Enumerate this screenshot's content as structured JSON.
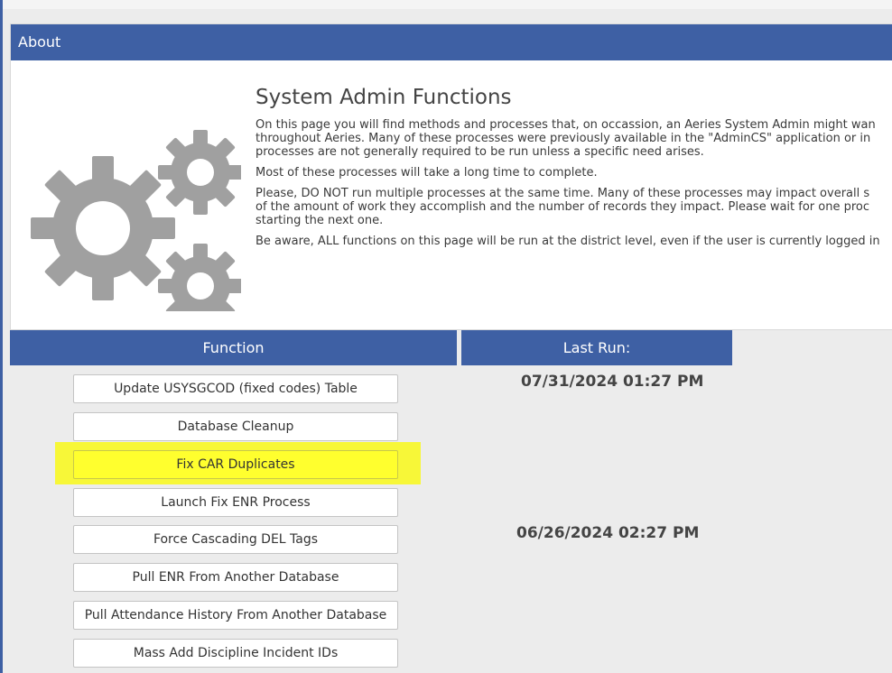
{
  "about": {
    "header": "About",
    "title": "System Admin Functions",
    "paragraphs": [
      [
        "On this page you will find methods and processes that, on occassion, an Aeries System Admin might wan",
        "throughout Aeries. Many of these processes were previously available in the \"AdminCS\" application or in",
        "processes are not generally required to be run unless a specific need arises."
      ],
      [
        "Most of these processes will take a long time to complete."
      ],
      [
        "Please, DO NOT run multiple processes at the same time. Many of these processes may impact overall s",
        "of the amount of work they accomplish and the number of records they impact. Please wait for one proc",
        "starting the next one."
      ],
      [
        "Be aware, ALL functions on this page will be run at the district level, even if the user is currently logged in"
      ]
    ],
    "icon": "gears-icon",
    "gear_color": "#a0a0a0"
  },
  "table": {
    "function_header": "Function",
    "last_run_header": "Last Run:"
  },
  "functions": [
    {
      "label": "Update USYSGCOD (fixed codes) Table"
    },
    {
      "label": "Database Cleanup"
    },
    {
      "label": "Fix CAR Duplicates",
      "highlighted": true
    },
    {
      "label": "Launch Fix ENR Process"
    },
    {
      "label": "Force Cascading DEL Tags"
    },
    {
      "label": "Pull ENR From Another Database"
    },
    {
      "label": "Pull Attendance History From Another Database"
    },
    {
      "label": "Mass Add Discipline Incident IDs"
    }
  ],
  "last_runs": [
    {
      "value": "07/31/2024 01:27 PM"
    },
    {
      "value": "06/26/2024 02:27 PM"
    }
  ],
  "colors": {
    "header_blue": "#3e60a4",
    "highlight_yellow": "#f7f738"
  }
}
